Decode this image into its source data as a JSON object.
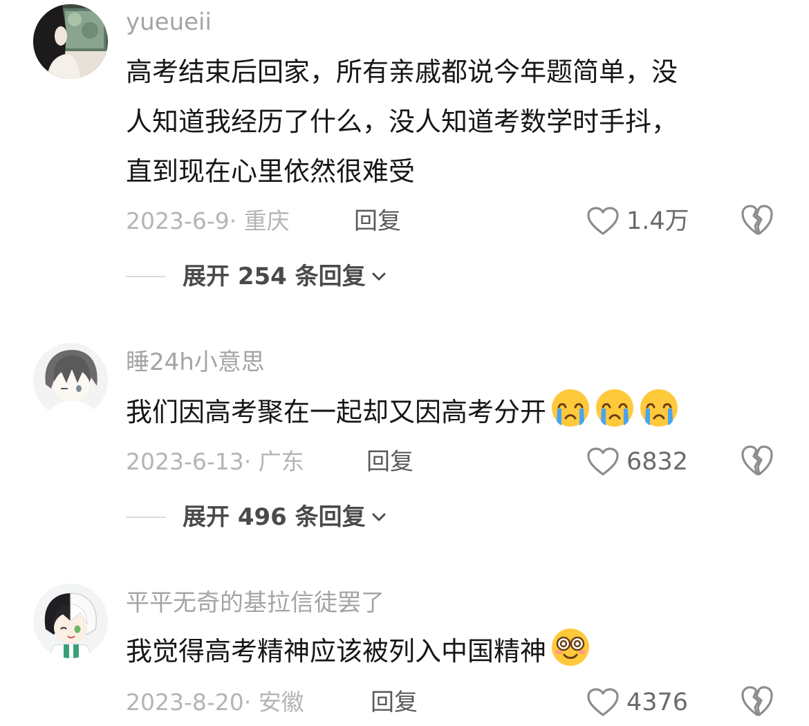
{
  "comments": [
    {
      "username": "yueueii",
      "content_lines": [
        "高考结束后回家，所有亲戚都说今年题简单，没",
        "人知道我经历了什么，没人知道考数学时手抖，",
        "直到现在心里依然很难受"
      ],
      "meta": "2023-6-9· 重庆",
      "reply_label": "回复",
      "likes": "1.4万",
      "expand_label": "展开 254 条回复"
    },
    {
      "username": "睡24h小意思",
      "content_lines": [
        "我们因高考聚在一起却又因高考分开"
      ],
      "emoji_icon": "crying-face-emoji",
      "meta": "2023-6-13· 广东",
      "reply_label": "回复",
      "likes": "6832",
      "expand_label": "展开 496 条回复"
    },
    {
      "username": "平平无奇的基拉信徒罢了",
      "content_lines": [
        "我觉得高考精神应该被列入中国精神"
      ],
      "emoji_icon": "dizzy-face-emoji",
      "meta": "2023-8-20· 安徽",
      "reply_label": "回复",
      "likes": "4376"
    }
  ],
  "icons": {
    "like": "heart-outline-icon",
    "dislike": "broken-heart-icon",
    "expand": "chevron-down-icon"
  },
  "colors": {
    "username": "#a4a4a4",
    "content": "#161616",
    "meta": "#b4b4b4",
    "emoji_face": "#ffc93c",
    "emoji_tears": "#4aa3f0"
  }
}
